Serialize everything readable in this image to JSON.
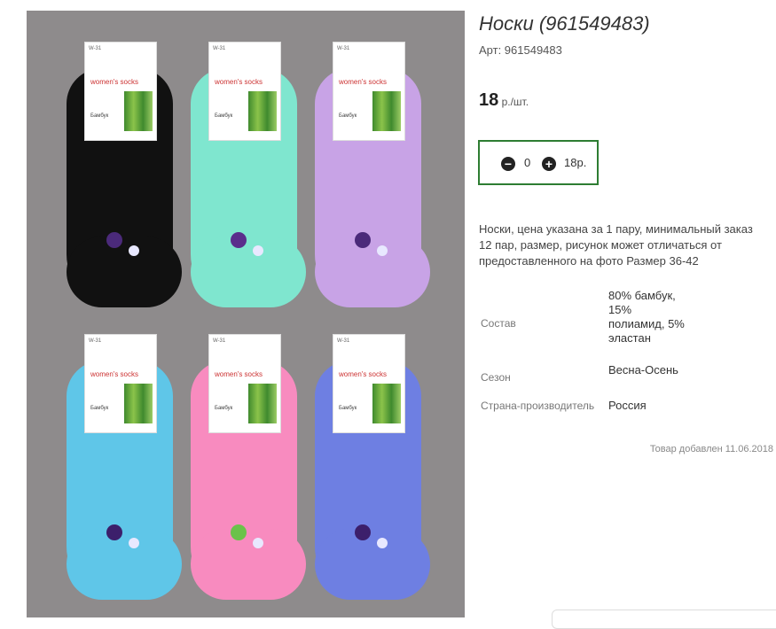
{
  "product": {
    "title": "Носки (961549483)",
    "article": "Арт: 961549483",
    "price": "18",
    "price_unit": " р./шт.",
    "quantity": "0",
    "sum": "18р.",
    "description": "Носки, цена указана за 1 пару, минимальный заказ 12 пар, размер, рисунок может отличаться от предоставленного на фото Размер 36-42",
    "added": "Товар добавлен 11.06.2018"
  },
  "props": [
    {
      "label": "Состав",
      "value": "80% бамбук, 15% полиамид, 5% эластан"
    },
    {
      "label": "Сезон",
      "value": "Весна-Осень"
    },
    {
      "label": "Страна-производитель",
      "value": "Россия"
    }
  ],
  "photo": {
    "socks": [
      {
        "color": "#111111",
        "flower": "#4b2a7a"
      },
      {
        "color": "#7fe6cf",
        "flower": "#5a2e8c"
      },
      {
        "color": "#c8a3e6",
        "flower": "#4b2a7a"
      },
      {
        "color": "#5fc6e8",
        "flower": "#3c1f6b"
      },
      {
        "color": "#f88bbf",
        "flower": "#6bc24a"
      },
      {
        "color": "#6e7fe2",
        "flower": "#3c1f6b"
      }
    ],
    "tag_header": "W-31",
    "tag_brand": "women's socks",
    "tag_material": "Бамбук"
  },
  "icons": {
    "minus": "minus-circle-icon",
    "plus": "plus-circle-icon"
  },
  "colors": {
    "accent": "#2e7d32"
  }
}
